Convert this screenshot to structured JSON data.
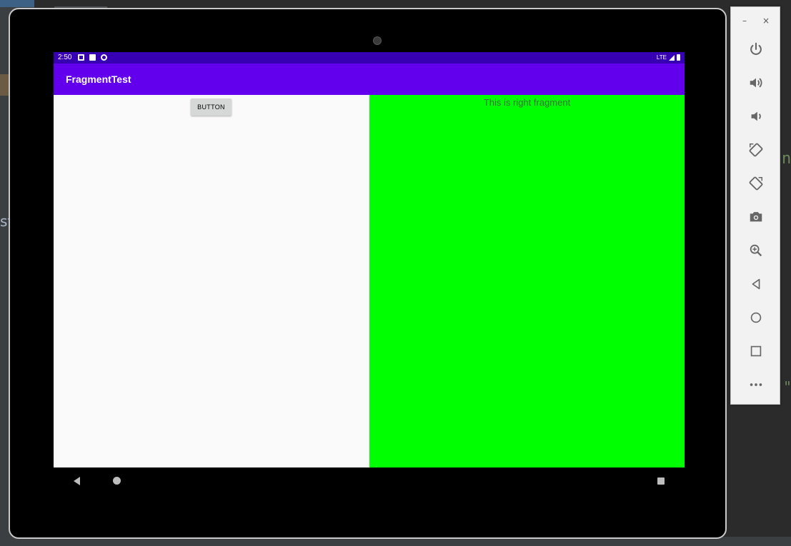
{
  "ide_background": {
    "left_fragment_text": "st",
    "right_fragment_text_1": "n",
    "right_fragment_text_2": "\""
  },
  "status_bar": {
    "time": "2:50",
    "network": "LTE"
  },
  "app_bar": {
    "title": "FragmentTest"
  },
  "left_fragment": {
    "button_label": "BUTTON"
  },
  "right_fragment": {
    "text": "This is right fragment",
    "background_color": "#00ff00"
  },
  "colors": {
    "status_bar": "#3700b3",
    "app_bar": "#6200ee",
    "left_fragment_bg": "#fafafa",
    "right_fragment_bg": "#00ff00"
  },
  "nav_bar": {
    "icons": [
      "back-icon",
      "home-icon",
      "recents-icon"
    ]
  },
  "emulator_toolbar": {
    "minimize_label": "–",
    "close_label": "×",
    "icons": [
      "power-icon",
      "volume-up-icon",
      "volume-down-icon",
      "rotate-left-icon",
      "rotate-right-icon",
      "camera-icon",
      "zoom-icon",
      "back-icon",
      "home-icon",
      "overview-icon",
      "more-icon"
    ]
  }
}
